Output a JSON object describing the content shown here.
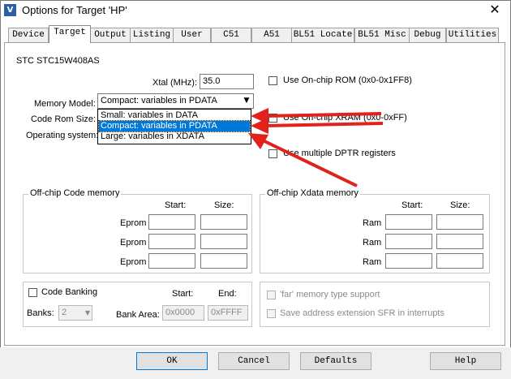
{
  "window": {
    "title": "Options for Target 'HP'",
    "icon": "uv-icon",
    "close_glyph": "✕"
  },
  "tabs": [
    {
      "label": "Device"
    },
    {
      "label": "Target"
    },
    {
      "label": "Output"
    },
    {
      "label": "Listing"
    },
    {
      "label": "User"
    },
    {
      "label": "C51"
    },
    {
      "label": "A51"
    },
    {
      "label": "BL51 Locate"
    },
    {
      "label": "BL51 Misc"
    },
    {
      "label": "Debug"
    },
    {
      "label": "Utilities"
    }
  ],
  "active_tab": "Target",
  "device_name": "STC STC15W408AS",
  "xtal": {
    "label": "Xtal (MHz):",
    "value": "35.0"
  },
  "memory_model": {
    "label": "Memory Model:",
    "value": "Compact: variables in PDATA",
    "options": [
      "Small: variables in DATA",
      "Compact: variables in PDATA",
      "Large: variables in XDATA"
    ],
    "selected_index": 1
  },
  "code_rom_size": {
    "label": "Code Rom Size:"
  },
  "operating_system": {
    "label": "Operating system:"
  },
  "checks": {
    "onchip_rom": "Use On-chip ROM (0x0-0x1FF8)",
    "onchip_xram": "Use On-chip XRAM (0x0-0xFF)",
    "multiple_dptr": "Use multiple DPTR registers"
  },
  "offchip_code": {
    "title": "Off-chip Code memory",
    "start_header": "Start:",
    "size_header": "Size:",
    "rows": [
      {
        "label": "Eprom"
      },
      {
        "label": "Eprom"
      },
      {
        "label": "Eprom"
      }
    ]
  },
  "offchip_xdata": {
    "title": "Off-chip Xdata memory",
    "start_header": "Start:",
    "size_header": "Size:",
    "rows": [
      {
        "label": "Ram"
      },
      {
        "label": "Ram"
      },
      {
        "label": "Ram"
      }
    ]
  },
  "code_banking": {
    "label": "Code Banking",
    "start_header": "Start:",
    "end_header": "End:",
    "banks_label": "Banks:",
    "banks_value": "2",
    "bank_area_label": "Bank Area:",
    "bank_area_start": "0x0000",
    "bank_area_end": "0xFFFF"
  },
  "far_memory": "'far' memory type support",
  "save_sfr": "Save address extension SFR in interrupts",
  "buttons": {
    "ok": "OK",
    "cancel": "Cancel",
    "defaults": "Defaults",
    "help": "Help"
  },
  "annotation_color": "#e0211c"
}
